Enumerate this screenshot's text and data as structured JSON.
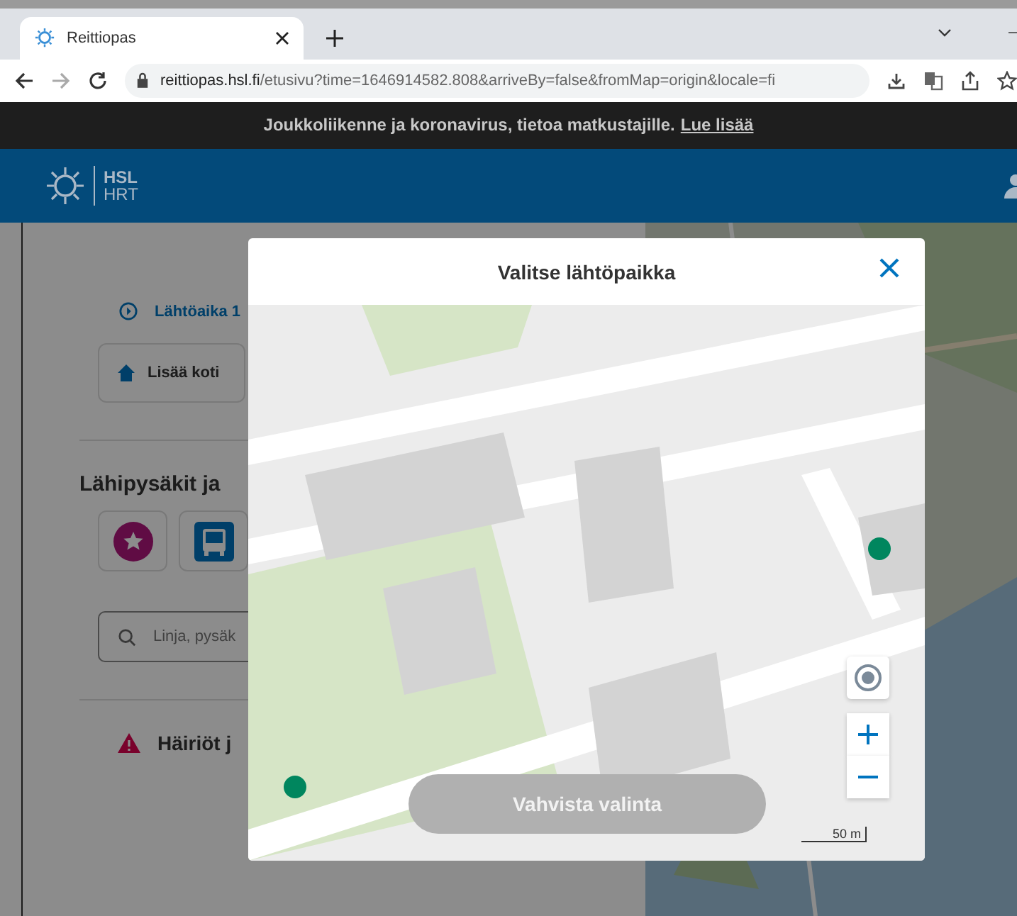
{
  "browser": {
    "tab_title": "Reittiopas",
    "url_host": "reittiopas.hsl.fi",
    "url_path": "/etusivu?time=1646914582.808&arriveBy=false&fromMap=origin&locale=fi"
  },
  "notice": {
    "text": "Joukkoliikenne ja koronavirus, tietoa matkustajille.",
    "link": "Lue lisää"
  },
  "header": {
    "logo_top": "HSL",
    "logo_bottom": "HRT"
  },
  "page": {
    "departure": "Lähtöaika 1",
    "home_button": "Lisää koti",
    "nearby_title": "Lähipysäkit ja",
    "mode_buttons": [
      {
        "kind": "favourite"
      },
      {
        "kind": "bus"
      }
    ],
    "search": {
      "placeholder": "Linja, pysäk"
    },
    "disruptions": "Häiriöt j"
  },
  "dialog": {
    "title": "Valitse lähtöpaikka",
    "scale": "50 m",
    "confirm": {
      "label": "Vahvista valinta",
      "disabled": true
    }
  }
}
